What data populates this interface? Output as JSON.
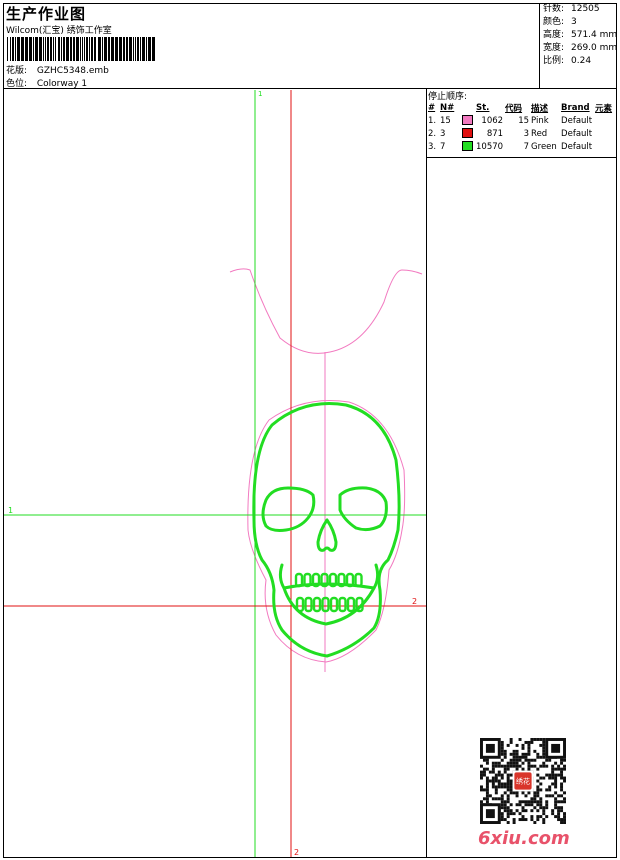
{
  "header": {
    "title": "生产作业图",
    "company": "Wilcom(汇宝) 绣饰工作室",
    "design_label": "花版:",
    "design_value": "GZHC5348.emb",
    "colorway_label": "色位:",
    "colorway_value": "Colorway 1"
  },
  "stats": [
    {
      "label": "针数:",
      "value": "12505"
    },
    {
      "label": "颜色:",
      "value": "3"
    },
    {
      "label": "高度:",
      "value": "571.4 mm"
    },
    {
      "label": "宽度:",
      "value": "269.0 mm"
    },
    {
      "label": "比例:",
      "value": "0.24"
    }
  ],
  "stop_sequence": {
    "title": "停止顺序:",
    "columns": [
      "#",
      "N#",
      "St.",
      "代码",
      "描述",
      "Brand",
      "元素"
    ],
    "rows": [
      {
        "idx": "1.",
        "needle": "15",
        "color": "#f27ac0",
        "stitches": "1062",
        "code": "15",
        "desc": "Pink",
        "brand": "Default"
      },
      {
        "idx": "2.",
        "needle": "3",
        "color": "#e01010",
        "stitches": "871",
        "code": "3",
        "desc": "Red",
        "brand": "Default"
      },
      {
        "idx": "3.",
        "needle": "7",
        "color": "#22dd22",
        "stitches": "10570",
        "code": "7",
        "desc": "Green",
        "brand": "Default"
      }
    ]
  },
  "guides": {
    "green_top": "1",
    "green_left": "1",
    "red_right": "2",
    "red_bottom": "2"
  },
  "colors": {
    "pink": "#f27ac0",
    "red": "#e01010",
    "green": "#22dd22"
  },
  "watermark": {
    "text": "6xiu.com",
    "stamp": "绣花"
  }
}
